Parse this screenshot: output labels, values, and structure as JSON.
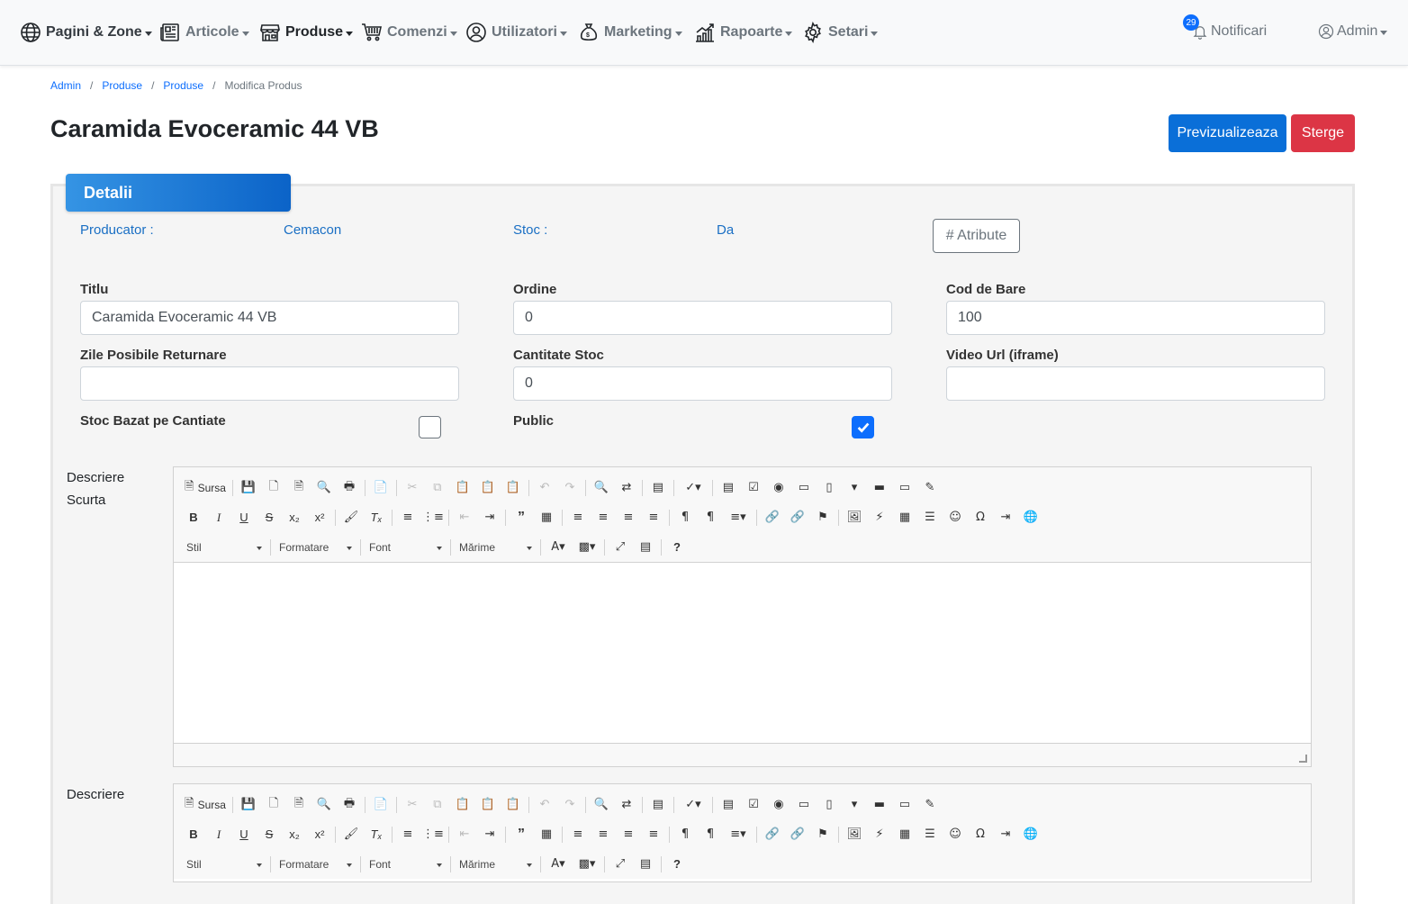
{
  "nav": {
    "items": [
      {
        "label": "Pagini & Zone",
        "icon": "globe-icon"
      },
      {
        "label": "Articole",
        "icon": "newspaper-icon"
      },
      {
        "label": "Produse",
        "icon": "shop-icon"
      },
      {
        "label": "Comenzi",
        "icon": "cart-icon"
      },
      {
        "label": "Utilizatori",
        "icon": "user-circle-icon"
      },
      {
        "label": "Marketing",
        "icon": "money-bag-icon"
      },
      {
        "label": "Rapoarte",
        "icon": "chart-icon"
      },
      {
        "label": "Setari",
        "icon": "gear-icon"
      }
    ],
    "notifications_label": "Notificari",
    "notifications_count": "29",
    "user_label": "Admin"
  },
  "breadcrumb": {
    "items": [
      "Admin",
      "Produse",
      "Produse"
    ],
    "current": "Modifica Produs"
  },
  "page": {
    "title": "Caramida Evoceramic 44 VB",
    "preview_button": "Previzualizeaza",
    "delete_button": "Sterge",
    "tab_label": "Detalii"
  },
  "info": {
    "producer_label": "Producator :",
    "producer_value": "Cemacon",
    "stock_label": "Stoc :",
    "stock_value": "Da",
    "attributes_button": "# Atribute"
  },
  "fields": {
    "titlu": {
      "label": "Titlu",
      "value": "Caramida Evoceramic 44 VB"
    },
    "ordine": {
      "label": "Ordine",
      "value": "0"
    },
    "cod_bare": {
      "label": "Cod de Bare",
      "value": "100"
    },
    "zile_returnare": {
      "label": "Zile Posibile Returnare",
      "value": ""
    },
    "cantitate_stoc": {
      "label": "Cantitate Stoc",
      "value": "0"
    },
    "video_url": {
      "label": "Video Url (iframe)",
      "value": ""
    },
    "stoc_bazat": {
      "label": "Stoc Bazat pe Cantiate",
      "checked": false
    },
    "public": {
      "label": "Public",
      "checked": true
    }
  },
  "editors": {
    "short_label": "Descriere Scurta",
    "long_label": "Descriere",
    "source_label": "Sursa",
    "combo_style": "Stil",
    "combo_format": "Formatare",
    "combo_font": "Font",
    "combo_size": "Mărime"
  },
  "colors": {
    "primary": "#0a6fd8",
    "danger": "#dc3545",
    "link": "#1a6fc4"
  }
}
